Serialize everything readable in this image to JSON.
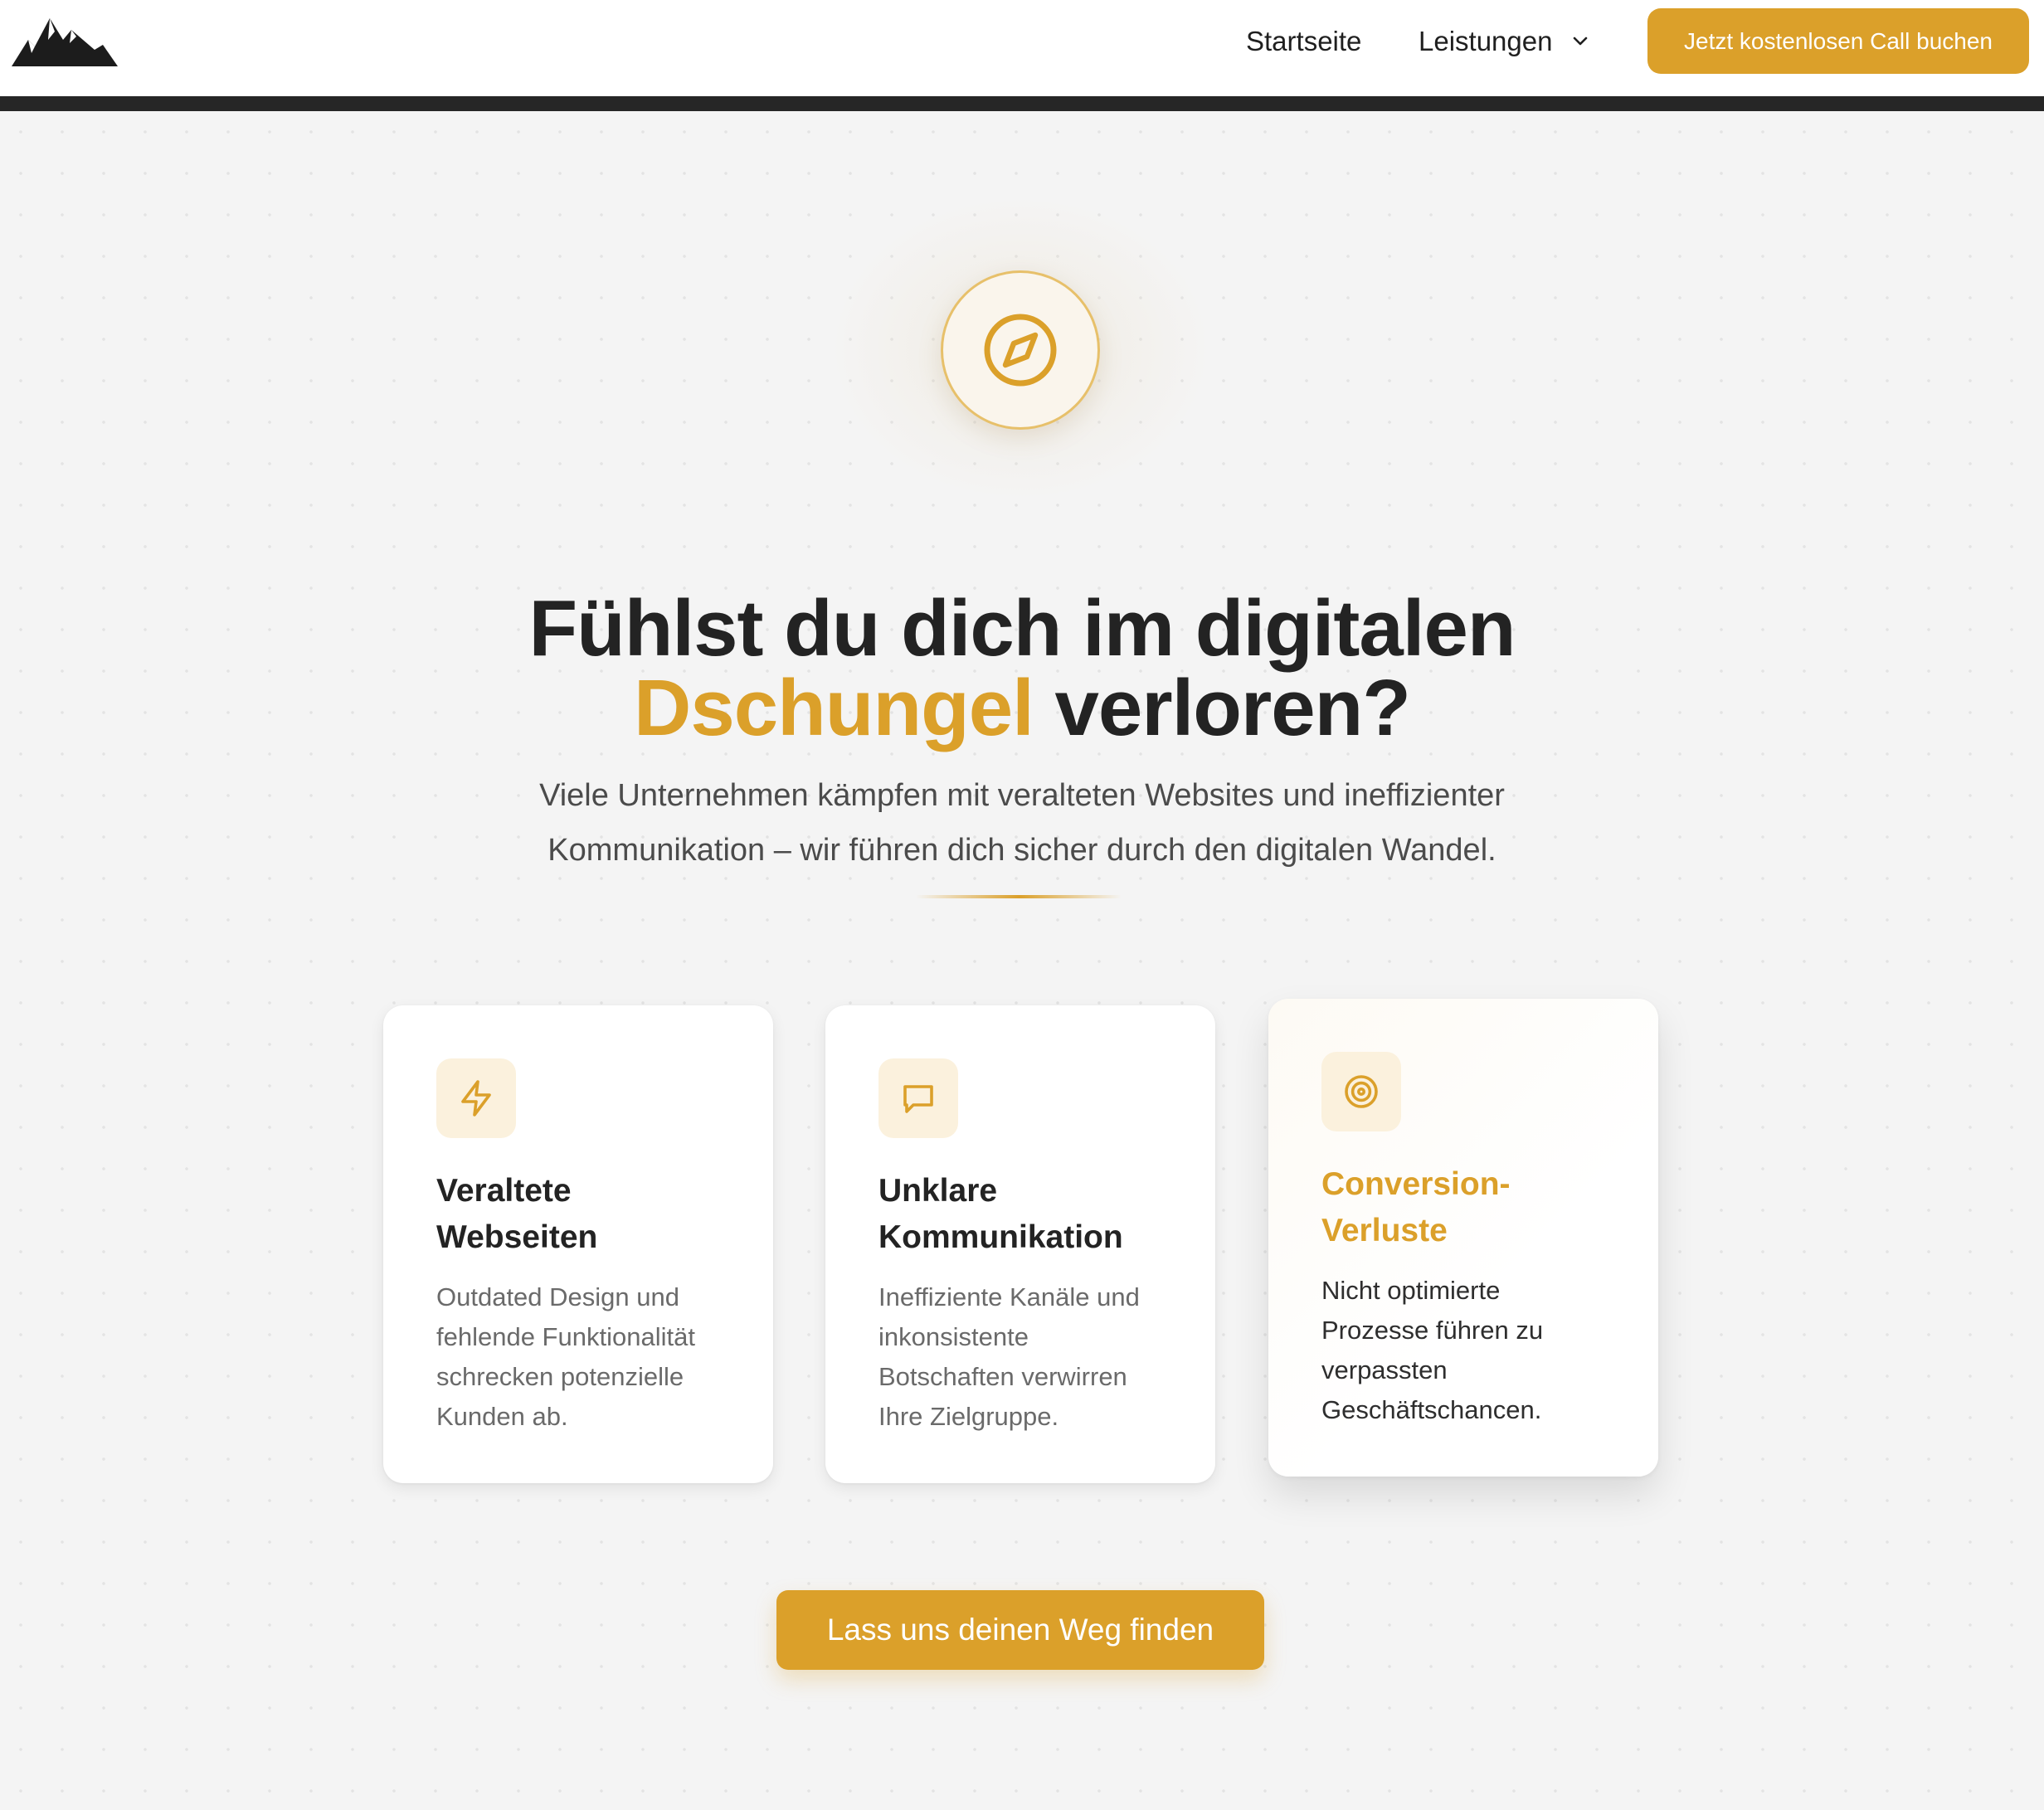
{
  "colors": {
    "accent": "#dba02a",
    "dark": "#232323",
    "background": "#f4f4f4",
    "header_bar": "#262626",
    "icon_tile": "#fbf1dd"
  },
  "header": {
    "logo_icon": "mountain-logo",
    "nav": {
      "home": "Startseite",
      "services": "Leistungen",
      "services_icon": "chevron-down-icon"
    },
    "cta_label": "Jetzt kostenlosen Call buchen"
  },
  "hero": {
    "badge_icon": "compass-icon",
    "title_line1": "Fühlst du dich im digitalen",
    "title_accent": "Dschungel",
    "title_rest": " verloren?",
    "subtitle_line1": "Viele Unternehmen kämpfen mit veralteten Websites und ineffizienter",
    "subtitle_line2": "Kommunikation – wir führen dich sicher durch den digitalen Wandel."
  },
  "cards": [
    {
      "icon": "lightning-icon",
      "title_line1": "Veraltete",
      "title_line2": "Webseiten",
      "desc": [
        "Outdated Design und",
        "fehlende Funktionalität",
        "schrecken potenzielle",
        "Kunden ab."
      ]
    },
    {
      "icon": "chat-icon",
      "title_line1": "Unklare",
      "title_line2": "Kommunikation",
      "desc": [
        "Ineffiziente Kanäle und",
        "inkonsistente",
        "Botschaften verwirren",
        "Ihre Zielgruppe."
      ]
    },
    {
      "icon": "target-icon",
      "title_line1": "Conversion-",
      "title_line2": "Verluste",
      "desc": [
        "Nicht optimierte",
        "Prozesse führen zu",
        "verpassten",
        "Geschäftschancen."
      ]
    }
  ],
  "cta": {
    "label": "Lass uns deinen Weg finden"
  }
}
